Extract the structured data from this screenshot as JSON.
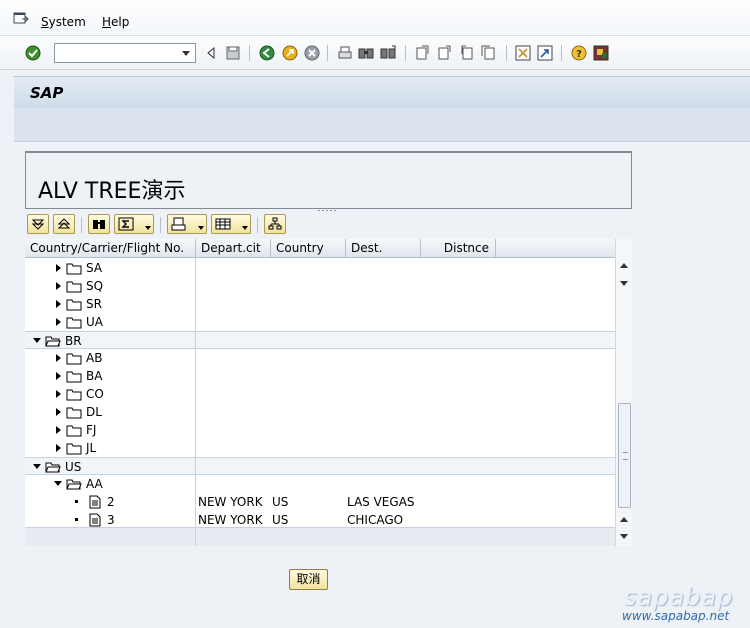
{
  "menu": {
    "system": "System",
    "help": "Help"
  },
  "command_field": {
    "value": ""
  },
  "title": "SAP",
  "header": {
    "text": "ALV TREE演示"
  },
  "columns": [
    "Country/Carrier/Flight No.",
    "Depart.cit",
    "Country",
    "Dest.",
    "Distnce"
  ],
  "rows": [
    {
      "level": 1,
      "type": "folder",
      "expanded": false,
      "label": "SA"
    },
    {
      "level": 1,
      "type": "folder",
      "expanded": false,
      "label": "SQ"
    },
    {
      "level": 1,
      "type": "folder",
      "expanded": false,
      "label": "SR"
    },
    {
      "level": 1,
      "type": "folder",
      "expanded": false,
      "label": "UA"
    },
    {
      "level": 0,
      "type": "folder",
      "expanded": true,
      "label": "BR"
    },
    {
      "level": 1,
      "type": "folder",
      "expanded": false,
      "label": "AB"
    },
    {
      "level": 1,
      "type": "folder",
      "expanded": false,
      "label": "BA"
    },
    {
      "level": 1,
      "type": "folder",
      "expanded": false,
      "label": "CO"
    },
    {
      "level": 1,
      "type": "folder",
      "expanded": false,
      "label": "DL"
    },
    {
      "level": 1,
      "type": "folder",
      "expanded": false,
      "label": "FJ"
    },
    {
      "level": 1,
      "type": "folder",
      "expanded": false,
      "label": "JL"
    },
    {
      "level": 0,
      "type": "folder",
      "expanded": true,
      "label": "US"
    },
    {
      "level": 1,
      "type": "folder",
      "expanded": true,
      "label": "AA"
    },
    {
      "level": 2,
      "type": "leaf",
      "label": "2",
      "depart_city": "NEW YORK",
      "country": "US",
      "dest": "LAS VEGAS",
      "distance": ""
    },
    {
      "level": 2,
      "type": "leaf",
      "label": "3",
      "depart_city": "NEW YORK",
      "country": "US",
      "dest": "CHICAGO",
      "distance": ""
    }
  ],
  "cancel_button": "取消",
  "watermark": {
    "brand": "sapabap",
    "url": "www.sapabap.net"
  },
  "colors": {
    "button_yellow": "#f1e49d",
    "title_blue": "#cfdbe9",
    "group_row": "#f1f4f8"
  }
}
